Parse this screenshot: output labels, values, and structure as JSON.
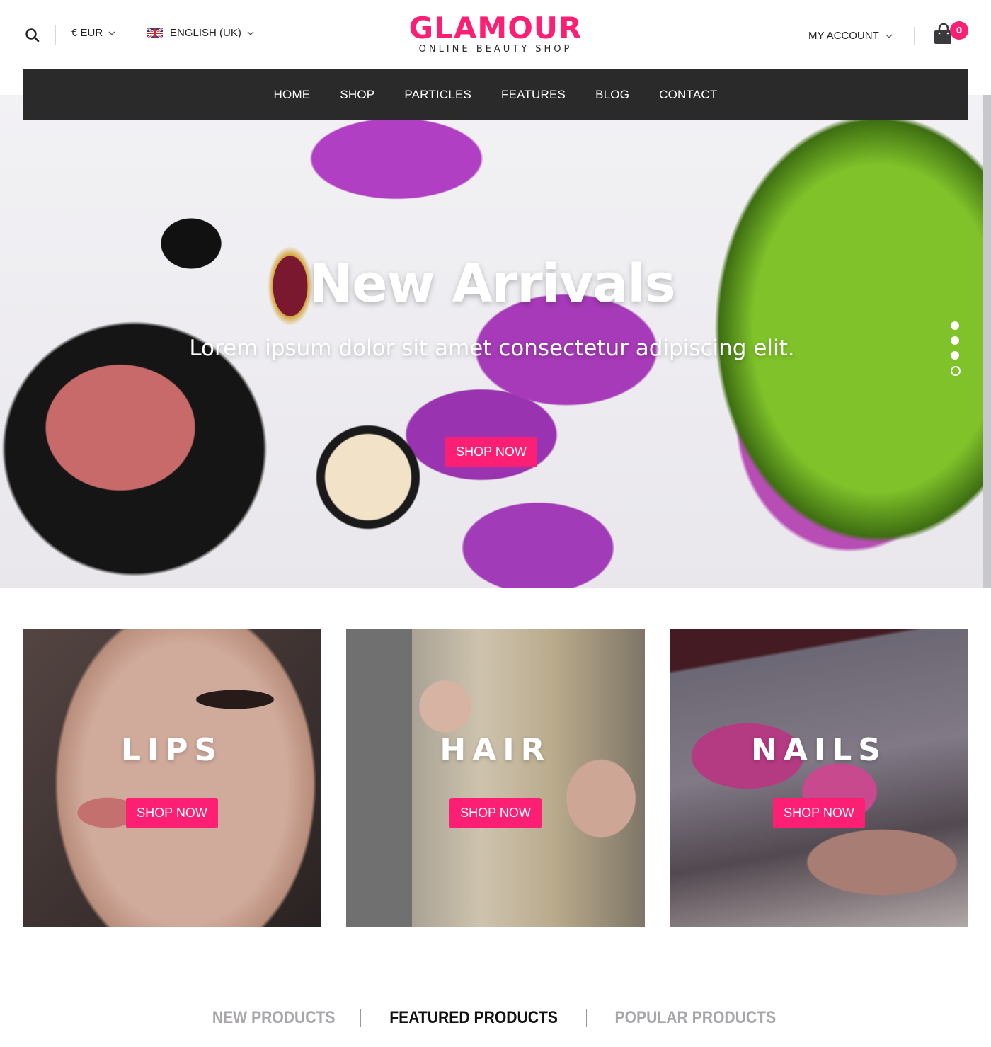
{
  "header": {
    "currency": "€ EUR",
    "language": "ENGLISH (UK)",
    "logo_title": "GLAMOUR",
    "logo_subtitle": "ONLINE BEAUTY SHOP",
    "account_label": "MY ACCOUNT",
    "cart_count": "0",
    "icons": {
      "search": "search-icon",
      "cart": "shopping-bag-icon",
      "flag": "uk-flag-icon",
      "chevron": "chevron-down-icon"
    }
  },
  "nav": {
    "items": [
      {
        "label": "HOME"
      },
      {
        "label": "SHOP"
      },
      {
        "label": "PARTICLES"
      },
      {
        "label": "FEATURES"
      },
      {
        "label": "BLOG"
      },
      {
        "label": "CONTACT"
      }
    ]
  },
  "hero": {
    "title": "New Arrivals",
    "subtitle": "Lorem ipsum dolor sit amet consectetur adipiscing elit.",
    "button_label": "SHOP NOW",
    "slides_total": 4,
    "active_slide": 4
  },
  "categories": [
    {
      "title": "LIPS",
      "button_label": "SHOP NOW"
    },
    {
      "title": "HAIR",
      "button_label": "SHOP NOW"
    },
    {
      "title": "NAILS",
      "button_label": "SHOP NOW"
    }
  ],
  "product_tabs": [
    {
      "label": "NEW PRODUCTS",
      "active": false
    },
    {
      "label": "FEATURED PRODUCTS",
      "active": true
    },
    {
      "label": "POPULAR PRODUCTS",
      "active": false
    }
  ],
  "colors": {
    "accent": "#fc1f74",
    "nav_background": "#2a2a2a",
    "inactive_tab": "#a8a6ab"
  }
}
